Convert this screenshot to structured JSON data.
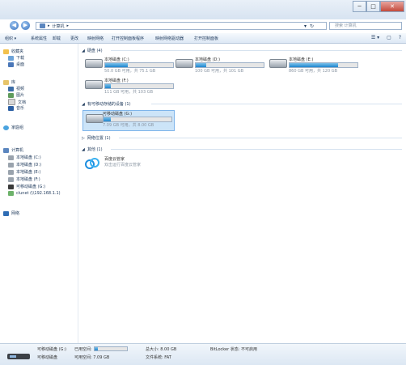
{
  "window": {
    "min_label": "─",
    "max_label": "□",
    "close_label": "✕"
  },
  "nav_buttons": {
    "back": "◀",
    "forward": "▶"
  },
  "address": {
    "root_icon": "computer-icon",
    "separator": "▸",
    "path": "计算机",
    "sep2": "▸",
    "dropdown": "▾",
    "refresh": "↻"
  },
  "search": {
    "placeholder": "搜索 计算机"
  },
  "toolbar": {
    "items": [
      "组织 ▾",
      "系统属性",
      "卸载",
      "更改",
      "映射网络",
      "打开控制面板程序",
      "映射网络驱动器",
      "打开控制面板"
    ],
    "right": {
      "view": "☰ ▾",
      "pane": "▢",
      "help": "?"
    }
  },
  "nav": {
    "favorites": "收藏夹",
    "downloads": "下载",
    "desktop": "桌面",
    "libraries": "库",
    "videos": "视频",
    "pictures": "图片",
    "documents": "文档",
    "music": "音乐",
    "homegroup": "家庭组",
    "computer": "计算机",
    "drives": [
      "本地磁盘 (C:)",
      "本地磁盘 (D:)",
      "本地磁盘 (E:)",
      "本地磁盘 (F:)",
      "可移动磁盘 (G:)"
    ],
    "share": "clunet (\\\\192.168.1.1)",
    "network": "网络"
  },
  "groups": {
    "hdd": "硬盘 (4)",
    "removable": "有可移动存储的设备 (1)",
    "network_loc": "网络位置 (1)",
    "other": "其他 (1)"
  },
  "drives": [
    {
      "name": "本地磁盘 (C:)",
      "size": "50.0 GB 可用，共 75.1 GB",
      "used": 0.33
    },
    {
      "name": "本地磁盘 (D:)",
      "size": "100 GB 可用，共 101 GB",
      "used": 0.16
    },
    {
      "name": "本地磁盘 (E:)",
      "size": "860 GB 可用，共 120 GB",
      "used": 0.72
    },
    {
      "name": "本地磁盘 (F:)",
      "size": "111 GB 可用，共 103 GB",
      "used": 0.08
    }
  ],
  "removable": {
    "name": "可移动磁盘 (G:)",
    "size": "7.09 GB 可用，共 8.00 GB",
    "used": 0.11
  },
  "other_item": {
    "name": "百度云管家",
    "desc": "双击运行百度云管家"
  },
  "status": {
    "name": "可移动磁盘 (G:)",
    "used_label": "已用空间:",
    "total_label": "总大小: 8.00 GB",
    "bitlocker": "BitLocker 状态: 不可启用",
    "type": "可移动磁盘",
    "free_label": "可用空间: 7.09 GB",
    "fs": "文件系统: FAT",
    "used": 0.11
  },
  "colors": {
    "bar_fill": "#1f86cf",
    "selected_bg": "#cce4f8",
    "titlebar": "#d7e3f1"
  }
}
